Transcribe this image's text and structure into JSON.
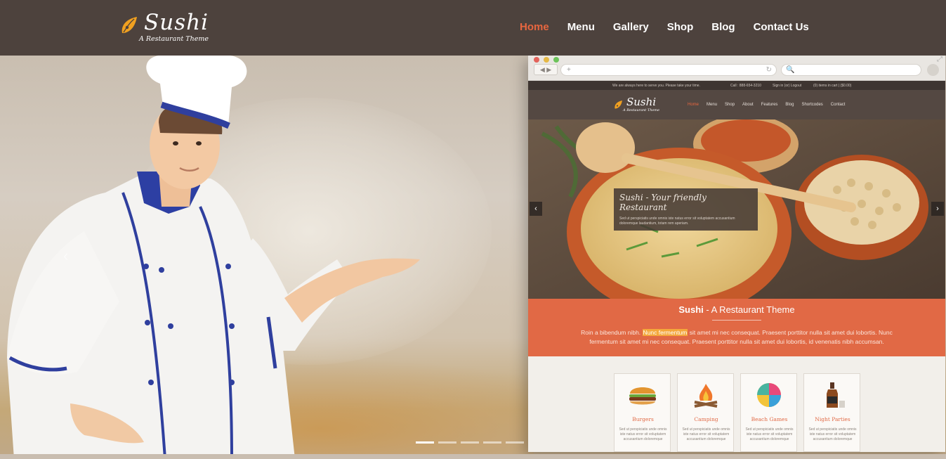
{
  "header": {
    "logo_word": "Sushi",
    "logo_tagline": "A Restaurant Theme",
    "nav": [
      {
        "label": "Home",
        "active": true
      },
      {
        "label": "Menu",
        "active": false
      },
      {
        "label": "Gallery",
        "active": false
      },
      {
        "label": "Shop",
        "active": false
      },
      {
        "label": "Blog",
        "active": false
      },
      {
        "label": "Contact Us",
        "active": false
      }
    ]
  },
  "hero": {
    "slider_dots": 5,
    "active_dot": 0,
    "prev_arrow": "‹"
  },
  "mockup": {
    "browser": {
      "back": "◀ ▶",
      "url_prefix": "+",
      "reload": "↻",
      "search_icon": "🔍",
      "expand": "⤢"
    },
    "topbar": {
      "message": "We are always here to serve you. Please take your time.",
      "call": "Call : 888-654-3210",
      "account": "Sign in (or) Logout",
      "cart": "(0) items in cart | ($0.00)"
    },
    "logo_word": "Sushi",
    "logo_tagline": "A Restaurant Theme",
    "nav": [
      {
        "label": "Home",
        "active": true
      },
      {
        "label": "Menu",
        "active": false
      },
      {
        "label": "Shop",
        "active": false
      },
      {
        "label": "About",
        "active": false
      },
      {
        "label": "Features",
        "active": false
      },
      {
        "label": "Blog",
        "active": false
      },
      {
        "label": "Shortcodes",
        "active": false
      },
      {
        "label": "Contact",
        "active": false
      }
    ],
    "caption": {
      "title": "Sushi - Your friendly Restaurant",
      "text": "Sed ut perspiciatis unde omnis iste natus error sit voluptatem accusantium doloremque laudantium, totam rem aperiam."
    },
    "arrows": {
      "prev": "‹",
      "next": "›"
    },
    "intro": {
      "title_bold": "Sushi",
      "title_rest": " - A Restaurant Theme",
      "text_before": "Roin a bibendum nibh. ",
      "text_highlight": "Nunc fermentum",
      "text_after": " sit amet mi nec consequat. Praesent porttitor nulla sit amet dui lobortis. Nunc fermentum sit amet mi nec consequat. Praesent porttitor nulla sit amet dui lobortis, id venenatis nibh accumsan."
    },
    "cards": [
      {
        "title": "Burgers",
        "icon": "burger-icon",
        "text": "Sed ut perspiciatis unde omnis iste natus error sit voluptatem accusantium doloremque"
      },
      {
        "title": "Camping",
        "icon": "campfire-icon",
        "text": "Sed ut perspiciatis unde omnis iste natus error sit voluptatem accusantium doloremque"
      },
      {
        "title": "Beach Games",
        "icon": "beach-ball-icon",
        "text": "Sed ut perspiciatis unde omnis iste natus error sit voluptatem accusantium doloremque"
      },
      {
        "title": "Night Parties",
        "icon": "bottle-icon",
        "text": "Sed ut perspiciatis unde omnis iste natus error sit voluptatem accusantium doloremque"
      }
    ]
  },
  "colors": {
    "header_bg": "#4d423d",
    "accent": "#e8663f",
    "mockup_orange": "#e16945"
  }
}
